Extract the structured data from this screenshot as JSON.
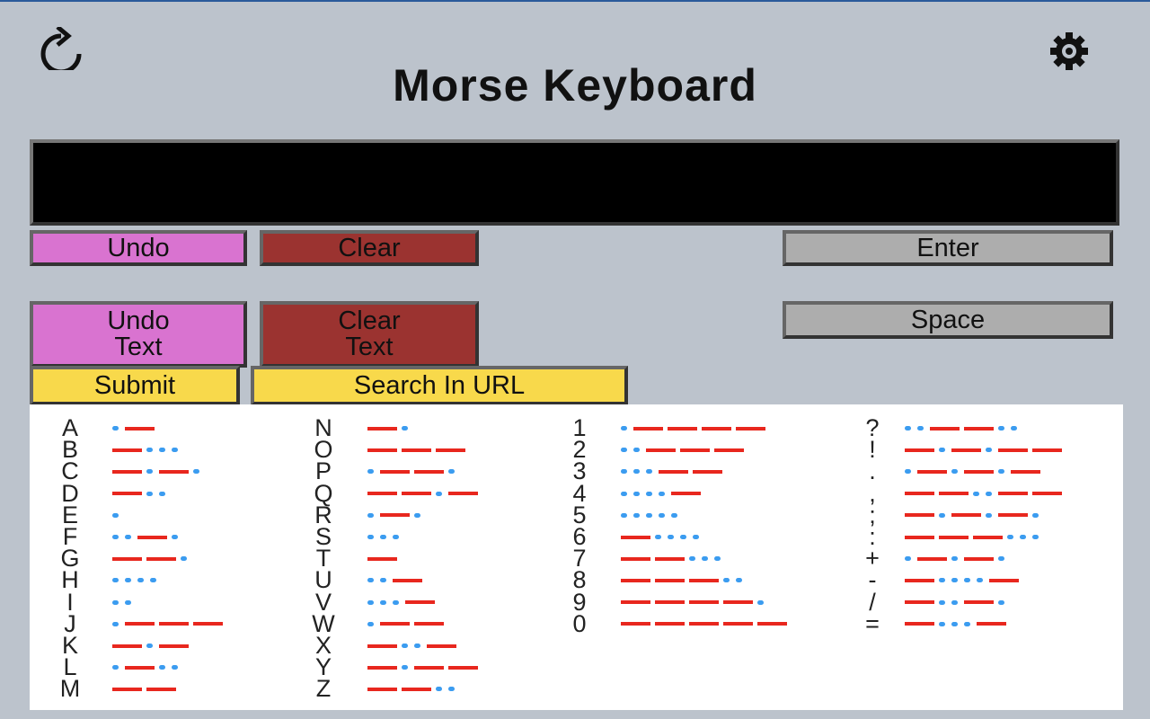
{
  "header": {
    "title": "Morse Keyboard",
    "refresh_icon": "refresh-icon",
    "settings_icon": "gear-icon"
  },
  "display": {
    "value": ""
  },
  "buttons": {
    "undo": "Undo",
    "clear": "Clear",
    "enter": "Enter",
    "undo_text_1": "Undo",
    "undo_text_2": "Text",
    "clear_text_1": "Clear",
    "clear_text_2": "Text",
    "space": "Space",
    "submit": "Submit",
    "search_url": "Search In URL"
  },
  "colors": {
    "dot": "#3b9cf0",
    "dash": "#e8271e",
    "undo": "#d973d0",
    "clear": "#9b3330",
    "enter": "#adadad",
    "submit": "#f8d94b"
  },
  "reference": {
    "columns": [
      [
        [
          "A",
          ".-"
        ],
        [
          "B",
          "-..."
        ],
        [
          "C",
          "-.-."
        ],
        [
          "D",
          "-.."
        ],
        [
          "E",
          "."
        ],
        [
          "F",
          "..-."
        ],
        [
          "G",
          "--."
        ],
        [
          "H",
          "...."
        ],
        [
          "I",
          ".."
        ],
        [
          "J",
          ".---"
        ],
        [
          "K",
          "-.-"
        ],
        [
          "L",
          ".-.."
        ],
        [
          "M",
          "--"
        ]
      ],
      [
        [
          "N",
          "-."
        ],
        [
          "O",
          "---"
        ],
        [
          "P",
          ".--."
        ],
        [
          "Q",
          "--.-"
        ],
        [
          "R",
          ".-."
        ],
        [
          "S",
          "..."
        ],
        [
          "T",
          "-"
        ],
        [
          "U",
          "..-"
        ],
        [
          "V",
          "...-"
        ],
        [
          "W",
          ".--"
        ],
        [
          "X",
          "-..-"
        ],
        [
          "Y",
          "-.--"
        ],
        [
          "Z",
          "--.."
        ]
      ],
      [
        [
          "1",
          ".----"
        ],
        [
          "2",
          "..---"
        ],
        [
          "3",
          "...--"
        ],
        [
          "4",
          "....-"
        ],
        [
          "5",
          "....."
        ],
        [
          "6",
          "-...."
        ],
        [
          "7",
          "--..."
        ],
        [
          "8",
          "---.."
        ],
        [
          "9",
          "----."
        ],
        [
          "0",
          "-----"
        ]
      ],
      [
        [
          "?",
          "..--.."
        ],
        [
          "!",
          "-.-.--"
        ],
        [
          ".",
          ".-.-.-"
        ],
        [
          ",",
          "--..--"
        ],
        [
          ";",
          "-.-.-."
        ],
        [
          ":",
          "---..."
        ],
        [
          "+",
          ".-.-."
        ],
        [
          "-",
          "-....-"
        ],
        [
          "/",
          "-..-."
        ],
        [
          "=",
          "-...-"
        ]
      ]
    ]
  }
}
